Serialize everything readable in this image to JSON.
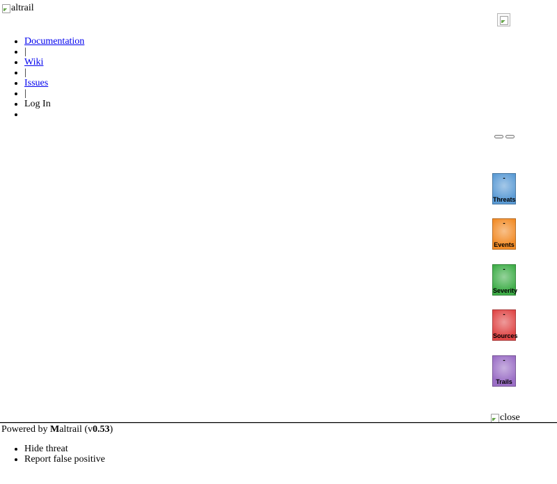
{
  "header": {
    "logo_alt": "altrail"
  },
  "nav": {
    "items": [
      {
        "label": "Documentation",
        "link": true
      },
      {
        "label": "|",
        "link": false
      },
      {
        "label": "Wiki",
        "link": true
      },
      {
        "label": "|",
        "link": false
      },
      {
        "label": "Issues",
        "link": true
      },
      {
        "label": "|",
        "link": false
      },
      {
        "label": "Log In",
        "link": false
      },
      {
        "label": "",
        "link": false
      }
    ]
  },
  "stats": [
    {
      "label": "Threats",
      "value": "-",
      "color": "#5b9bd5"
    },
    {
      "label": "Events",
      "value": "-",
      "color": "#f28c28"
    },
    {
      "label": "Severity",
      "value": "-",
      "color": "#3fae49"
    },
    {
      "label": "Sources",
      "value": "-",
      "color": "#e04848"
    },
    {
      "label": "Trails",
      "value": "-",
      "color": "#9b6fc6"
    }
  ],
  "close_alt": "close",
  "footer": {
    "powered_prefix": "Powered by ",
    "brand_m": "M",
    "brand_rest": "altrail",
    "version_open": " (v",
    "version": "0.53",
    "version_close": ")"
  },
  "context_menu": {
    "items": [
      "Hide threat",
      "Report false positive"
    ]
  }
}
